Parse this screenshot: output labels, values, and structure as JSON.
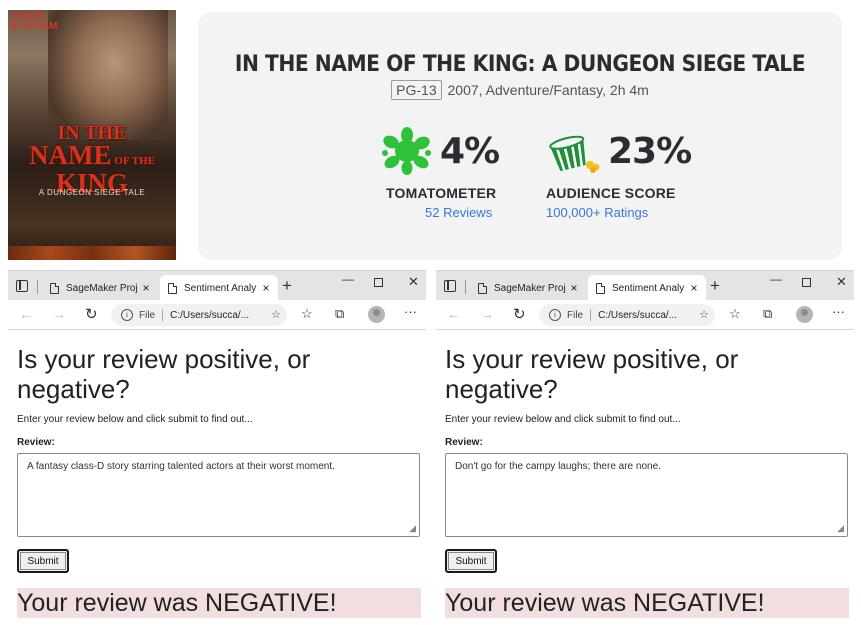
{
  "poster": {
    "actor_name": "JASON\nSTATHAM",
    "title_art": "IN THE NAME OF THE KING",
    "subtitle_art": "A DUNGEON SIEGE TALE"
  },
  "movie": {
    "title": "IN THE NAME OF THE KING: A DUNGEON SIEGE TALE",
    "rating": "PG-13",
    "details": "2007, Adventure/Fantasy, 2h 4m"
  },
  "scores": {
    "tomatometer": {
      "value": "4%",
      "label": "TOMATOMETER",
      "count": "52 Reviews",
      "icon": "splat-icon"
    },
    "audience": {
      "value": "23%",
      "label": "AUDIENCE SCORE",
      "count": "100,000+ Ratings",
      "icon": "spilled-popcorn-icon"
    }
  },
  "colors": {
    "splat_green": "#2fc139",
    "popcorn_green": "#1e8f3a",
    "link_blue": "#3976dc",
    "negative_banner": "#f2dede"
  },
  "browsers": [
    {
      "tabs": [
        {
          "label": "SageMaker Proje",
          "close": "×"
        },
        {
          "label": "Sentiment Analy",
          "close": "×"
        }
      ],
      "new_tab": "+",
      "url_scheme": "File",
      "url": "C:/Users/succa/...",
      "heading": "Is your review positive, or negative?",
      "description": "Enter your review below and click submit to find out...",
      "review_label": "Review:",
      "review_text": "A fantasy class-D story starring talented actors at their worst moment.",
      "submit_label": "Submit",
      "result": "Your review was NEGATIVE!"
    },
    {
      "tabs": [
        {
          "label": "SageMaker Proje",
          "close": "×"
        },
        {
          "label": "Sentiment Analy",
          "close": "×"
        }
      ],
      "new_tab": "+",
      "url_scheme": "File",
      "url": "C:/Users/succa/...",
      "heading": "Is your review positive, or negative?",
      "description": "Enter your review below and click submit to find out...",
      "review_label": "Review:",
      "review_text": "Don't go for the campy laughs; there are none.",
      "submit_label": "Submit",
      "result": "Your review was NEGATIVE!"
    }
  ]
}
